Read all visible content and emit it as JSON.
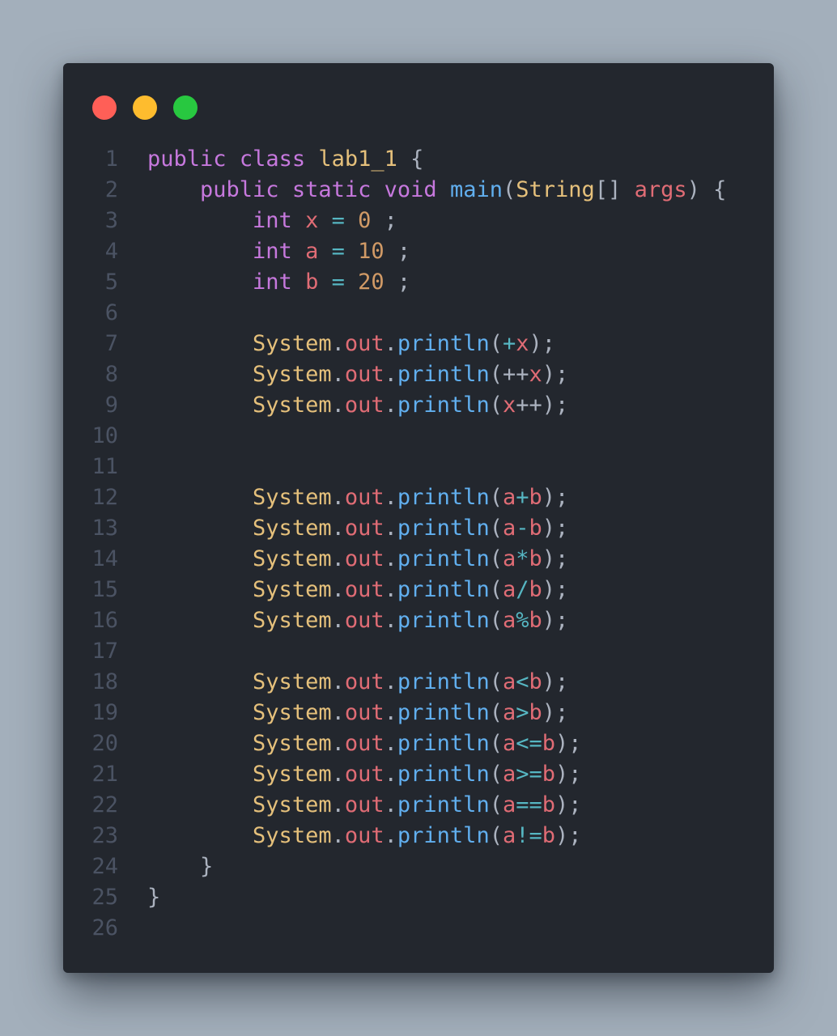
{
  "window": {
    "buttons": {
      "close_color": "#ff5f57",
      "minimize_color": "#febc2e",
      "maximize_color": "#28c840"
    }
  },
  "editor": {
    "theme": {
      "background": "#23272e",
      "line_number": "#4b5363",
      "keyword": "#c678dd",
      "class_name": "#e5c07b",
      "method": "#61afef",
      "variable": "#e06c75",
      "number": "#d19a66",
      "operator": "#56b6c2",
      "plain": "#abb2bf"
    },
    "lines": [
      {
        "number": "1",
        "tokens": [
          {
            "text": "public",
            "type": "keyword"
          },
          {
            "text": " ",
            "type": "plain"
          },
          {
            "text": "class",
            "type": "keyword"
          },
          {
            "text": " ",
            "type": "plain"
          },
          {
            "text": "lab1_1",
            "type": "class_name"
          },
          {
            "text": " {",
            "type": "plain"
          }
        ]
      },
      {
        "number": "2",
        "tokens": [
          {
            "text": "    ",
            "type": "plain"
          },
          {
            "text": "public",
            "type": "keyword"
          },
          {
            "text": " ",
            "type": "plain"
          },
          {
            "text": "static",
            "type": "keyword"
          },
          {
            "text": " ",
            "type": "plain"
          },
          {
            "text": "void",
            "type": "keyword"
          },
          {
            "text": " ",
            "type": "plain"
          },
          {
            "text": "main",
            "type": "method"
          },
          {
            "text": "(",
            "type": "plain"
          },
          {
            "text": "String",
            "type": "class_name"
          },
          {
            "text": "[] ",
            "type": "plain"
          },
          {
            "text": "args",
            "type": "variable"
          },
          {
            "text": ") {",
            "type": "plain"
          }
        ]
      },
      {
        "number": "3",
        "tokens": [
          {
            "text": "        ",
            "type": "plain"
          },
          {
            "text": "int",
            "type": "keyword"
          },
          {
            "text": " ",
            "type": "plain"
          },
          {
            "text": "x",
            "type": "variable"
          },
          {
            "text": " ",
            "type": "plain"
          },
          {
            "text": "=",
            "type": "operator"
          },
          {
            "text": " ",
            "type": "plain"
          },
          {
            "text": "0",
            "type": "number"
          },
          {
            "text": " ;",
            "type": "plain"
          }
        ]
      },
      {
        "number": "4",
        "tokens": [
          {
            "text": "        ",
            "type": "plain"
          },
          {
            "text": "int",
            "type": "keyword"
          },
          {
            "text": " ",
            "type": "plain"
          },
          {
            "text": "a",
            "type": "variable"
          },
          {
            "text": " ",
            "type": "plain"
          },
          {
            "text": "=",
            "type": "operator"
          },
          {
            "text": " ",
            "type": "plain"
          },
          {
            "text": "10",
            "type": "number"
          },
          {
            "text": " ;",
            "type": "plain"
          }
        ]
      },
      {
        "number": "5",
        "tokens": [
          {
            "text": "        ",
            "type": "plain"
          },
          {
            "text": "int",
            "type": "keyword"
          },
          {
            "text": " ",
            "type": "plain"
          },
          {
            "text": "b",
            "type": "variable"
          },
          {
            "text": " ",
            "type": "plain"
          },
          {
            "text": "=",
            "type": "operator"
          },
          {
            "text": " ",
            "type": "plain"
          },
          {
            "text": "20",
            "type": "number"
          },
          {
            "text": " ;",
            "type": "plain"
          }
        ]
      },
      {
        "number": "6",
        "tokens": []
      },
      {
        "number": "7",
        "tokens": [
          {
            "text": "        ",
            "type": "plain"
          },
          {
            "text": "System",
            "type": "class_name"
          },
          {
            "text": ".",
            "type": "plain"
          },
          {
            "text": "out",
            "type": "variable"
          },
          {
            "text": ".",
            "type": "plain"
          },
          {
            "text": "println",
            "type": "method"
          },
          {
            "text": "(",
            "type": "plain"
          },
          {
            "text": "+",
            "type": "operator"
          },
          {
            "text": "x",
            "type": "variable"
          },
          {
            "text": ");",
            "type": "plain"
          }
        ]
      },
      {
        "number": "8",
        "tokens": [
          {
            "text": "        ",
            "type": "plain"
          },
          {
            "text": "System",
            "type": "class_name"
          },
          {
            "text": ".",
            "type": "plain"
          },
          {
            "text": "out",
            "type": "variable"
          },
          {
            "text": ".",
            "type": "plain"
          },
          {
            "text": "println",
            "type": "method"
          },
          {
            "text": "(",
            "type": "plain"
          },
          {
            "text": "++",
            "type": "plain"
          },
          {
            "text": "x",
            "type": "variable"
          },
          {
            "text": ");",
            "type": "plain"
          }
        ]
      },
      {
        "number": "9",
        "tokens": [
          {
            "text": "        ",
            "type": "plain"
          },
          {
            "text": "System",
            "type": "class_name"
          },
          {
            "text": ".",
            "type": "plain"
          },
          {
            "text": "out",
            "type": "variable"
          },
          {
            "text": ".",
            "type": "plain"
          },
          {
            "text": "println",
            "type": "method"
          },
          {
            "text": "(",
            "type": "plain"
          },
          {
            "text": "x",
            "type": "variable"
          },
          {
            "text": "++",
            "type": "plain"
          },
          {
            "text": ");",
            "type": "plain"
          }
        ]
      },
      {
        "number": "10",
        "tokens": []
      },
      {
        "number": "11",
        "tokens": []
      },
      {
        "number": "12",
        "tokens": [
          {
            "text": "        ",
            "type": "plain"
          },
          {
            "text": "System",
            "type": "class_name"
          },
          {
            "text": ".",
            "type": "plain"
          },
          {
            "text": "out",
            "type": "variable"
          },
          {
            "text": ".",
            "type": "plain"
          },
          {
            "text": "println",
            "type": "method"
          },
          {
            "text": "(",
            "type": "plain"
          },
          {
            "text": "a",
            "type": "variable"
          },
          {
            "text": "+",
            "type": "operator"
          },
          {
            "text": "b",
            "type": "variable"
          },
          {
            "text": ");",
            "type": "plain"
          }
        ]
      },
      {
        "number": "13",
        "tokens": [
          {
            "text": "        ",
            "type": "plain"
          },
          {
            "text": "System",
            "type": "class_name"
          },
          {
            "text": ".",
            "type": "plain"
          },
          {
            "text": "out",
            "type": "variable"
          },
          {
            "text": ".",
            "type": "plain"
          },
          {
            "text": "println",
            "type": "method"
          },
          {
            "text": "(",
            "type": "plain"
          },
          {
            "text": "a",
            "type": "variable"
          },
          {
            "text": "-",
            "type": "operator"
          },
          {
            "text": "b",
            "type": "variable"
          },
          {
            "text": ");",
            "type": "plain"
          }
        ]
      },
      {
        "number": "14",
        "tokens": [
          {
            "text": "        ",
            "type": "plain"
          },
          {
            "text": "System",
            "type": "class_name"
          },
          {
            "text": ".",
            "type": "plain"
          },
          {
            "text": "out",
            "type": "variable"
          },
          {
            "text": ".",
            "type": "plain"
          },
          {
            "text": "println",
            "type": "method"
          },
          {
            "text": "(",
            "type": "plain"
          },
          {
            "text": "a",
            "type": "variable"
          },
          {
            "text": "*",
            "type": "operator"
          },
          {
            "text": "b",
            "type": "variable"
          },
          {
            "text": ");",
            "type": "plain"
          }
        ]
      },
      {
        "number": "15",
        "tokens": [
          {
            "text": "        ",
            "type": "plain"
          },
          {
            "text": "System",
            "type": "class_name"
          },
          {
            "text": ".",
            "type": "plain"
          },
          {
            "text": "out",
            "type": "variable"
          },
          {
            "text": ".",
            "type": "plain"
          },
          {
            "text": "println",
            "type": "method"
          },
          {
            "text": "(",
            "type": "plain"
          },
          {
            "text": "a",
            "type": "variable"
          },
          {
            "text": "/",
            "type": "operator"
          },
          {
            "text": "b",
            "type": "variable"
          },
          {
            "text": ");",
            "type": "plain"
          }
        ]
      },
      {
        "number": "16",
        "tokens": [
          {
            "text": "        ",
            "type": "plain"
          },
          {
            "text": "System",
            "type": "class_name"
          },
          {
            "text": ".",
            "type": "plain"
          },
          {
            "text": "out",
            "type": "variable"
          },
          {
            "text": ".",
            "type": "plain"
          },
          {
            "text": "println",
            "type": "method"
          },
          {
            "text": "(",
            "type": "plain"
          },
          {
            "text": "a",
            "type": "variable"
          },
          {
            "text": "%",
            "type": "operator"
          },
          {
            "text": "b",
            "type": "variable"
          },
          {
            "text": ");",
            "type": "plain"
          }
        ]
      },
      {
        "number": "17",
        "tokens": []
      },
      {
        "number": "18",
        "tokens": [
          {
            "text": "        ",
            "type": "plain"
          },
          {
            "text": "System",
            "type": "class_name"
          },
          {
            "text": ".",
            "type": "plain"
          },
          {
            "text": "out",
            "type": "variable"
          },
          {
            "text": ".",
            "type": "plain"
          },
          {
            "text": "println",
            "type": "method"
          },
          {
            "text": "(",
            "type": "plain"
          },
          {
            "text": "a",
            "type": "variable"
          },
          {
            "text": "<",
            "type": "operator"
          },
          {
            "text": "b",
            "type": "variable"
          },
          {
            "text": ");",
            "type": "plain"
          }
        ]
      },
      {
        "number": "19",
        "tokens": [
          {
            "text": "        ",
            "type": "plain"
          },
          {
            "text": "System",
            "type": "class_name"
          },
          {
            "text": ".",
            "type": "plain"
          },
          {
            "text": "out",
            "type": "variable"
          },
          {
            "text": ".",
            "type": "plain"
          },
          {
            "text": "println",
            "type": "method"
          },
          {
            "text": "(",
            "type": "plain"
          },
          {
            "text": "a",
            "type": "variable"
          },
          {
            "text": ">",
            "type": "operator"
          },
          {
            "text": "b",
            "type": "variable"
          },
          {
            "text": ");",
            "type": "plain"
          }
        ]
      },
      {
        "number": "20",
        "tokens": [
          {
            "text": "        ",
            "type": "plain"
          },
          {
            "text": "System",
            "type": "class_name"
          },
          {
            "text": ".",
            "type": "plain"
          },
          {
            "text": "out",
            "type": "variable"
          },
          {
            "text": ".",
            "type": "plain"
          },
          {
            "text": "println",
            "type": "method"
          },
          {
            "text": "(",
            "type": "plain"
          },
          {
            "text": "a",
            "type": "variable"
          },
          {
            "text": "<=",
            "type": "operator"
          },
          {
            "text": "b",
            "type": "variable"
          },
          {
            "text": ");",
            "type": "plain"
          }
        ]
      },
      {
        "number": "21",
        "tokens": [
          {
            "text": "        ",
            "type": "plain"
          },
          {
            "text": "System",
            "type": "class_name"
          },
          {
            "text": ".",
            "type": "plain"
          },
          {
            "text": "out",
            "type": "variable"
          },
          {
            "text": ".",
            "type": "plain"
          },
          {
            "text": "println",
            "type": "method"
          },
          {
            "text": "(",
            "type": "plain"
          },
          {
            "text": "a",
            "type": "variable"
          },
          {
            "text": ">=",
            "type": "operator"
          },
          {
            "text": "b",
            "type": "variable"
          },
          {
            "text": ");",
            "type": "plain"
          }
        ]
      },
      {
        "number": "22",
        "tokens": [
          {
            "text": "        ",
            "type": "plain"
          },
          {
            "text": "System",
            "type": "class_name"
          },
          {
            "text": ".",
            "type": "plain"
          },
          {
            "text": "out",
            "type": "variable"
          },
          {
            "text": ".",
            "type": "plain"
          },
          {
            "text": "println",
            "type": "method"
          },
          {
            "text": "(",
            "type": "plain"
          },
          {
            "text": "a",
            "type": "variable"
          },
          {
            "text": "==",
            "type": "operator"
          },
          {
            "text": "b",
            "type": "variable"
          },
          {
            "text": ");",
            "type": "plain"
          }
        ]
      },
      {
        "number": "23",
        "tokens": [
          {
            "text": "        ",
            "type": "plain"
          },
          {
            "text": "System",
            "type": "class_name"
          },
          {
            "text": ".",
            "type": "plain"
          },
          {
            "text": "out",
            "type": "variable"
          },
          {
            "text": ".",
            "type": "plain"
          },
          {
            "text": "println",
            "type": "method"
          },
          {
            "text": "(",
            "type": "plain"
          },
          {
            "text": "a",
            "type": "variable"
          },
          {
            "text": "!=",
            "type": "operator"
          },
          {
            "text": "b",
            "type": "variable"
          },
          {
            "text": ");",
            "type": "plain"
          }
        ]
      },
      {
        "number": "24",
        "tokens": [
          {
            "text": "    }",
            "type": "plain"
          }
        ]
      },
      {
        "number": "25",
        "tokens": [
          {
            "text": "}",
            "type": "plain"
          }
        ]
      },
      {
        "number": "26",
        "tokens": []
      }
    ]
  }
}
